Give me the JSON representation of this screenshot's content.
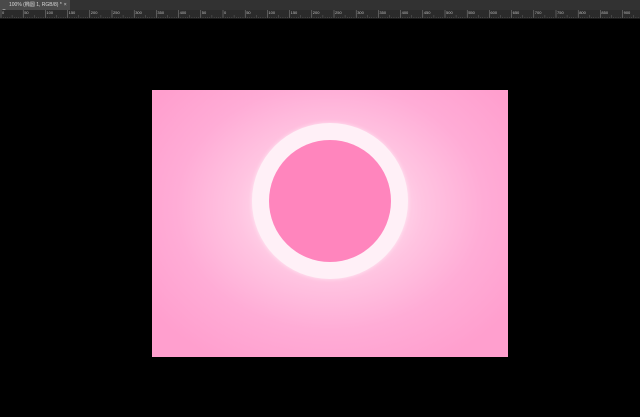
{
  "document_tab": {
    "title": "100% (椭圆 1, RGB/8) *",
    "close_glyph": "×",
    "icon": "document-icon"
  },
  "ruler": {
    "labels": [
      "0",
      "50",
      "100",
      "150",
      "200",
      "250",
      "300",
      "350",
      "400",
      "50",
      "0",
      "50",
      "100",
      "150",
      "200",
      "250",
      "300",
      "350",
      "400",
      "450",
      "500",
      "550",
      "600",
      "650",
      "700",
      "750",
      "800",
      "850",
      "900",
      "950",
      "1000",
      "1050"
    ]
  },
  "canvas": {
    "background_center_color": "#ffffff",
    "background_edge_color": "#ff9fce",
    "ring_color": "#fff0f7",
    "disc_color": "#ff85bd"
  },
  "workspace": {
    "background_color": "#000000"
  }
}
